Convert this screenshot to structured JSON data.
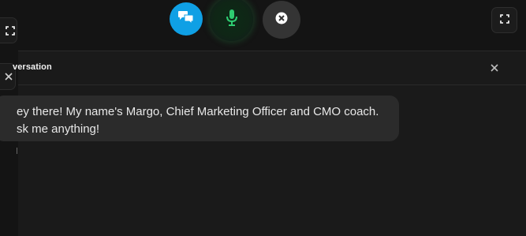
{
  "controls": {
    "chat_icon": "chat-bubbles-icon",
    "mic_icon": "microphone-icon",
    "end_icon": "close-circle-icon",
    "fullscreen_icon": "expand-icon",
    "chat_color": "#0fa0e5",
    "mic_color": "#2ecc71",
    "end_color": "#343434"
  },
  "side": {
    "expand_icon": "expand-icon",
    "close_icon": "close-icon"
  },
  "panel": {
    "title": "versation",
    "close_icon": "close-icon"
  },
  "messages": [
    {
      "line1": "ey there! My name's Margo, Chief Marketing Officer and CMO coach.",
      "line2": "sk me anything!"
    }
  ]
}
